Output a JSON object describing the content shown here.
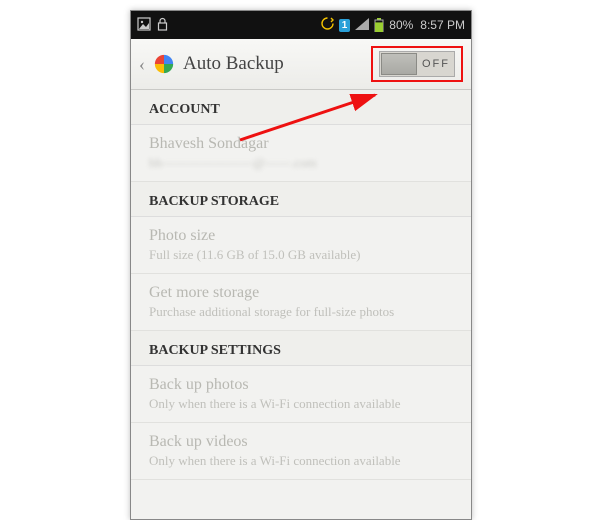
{
  "status_bar": {
    "sim_label": "1",
    "battery_text": "80%",
    "time": "8:57 PM"
  },
  "header": {
    "title": "Auto Backup",
    "toggle_state": "OFF"
  },
  "sections": {
    "account": {
      "header": "ACCOUNT",
      "name": "Bhavesh Sondagar",
      "email": "bh———————@——.com"
    },
    "storage": {
      "header": "BACKUP STORAGE",
      "photo_size_title": "Photo size",
      "photo_size_sub": "Full size (11.6 GB of 15.0 GB available)",
      "get_more_title": "Get more storage",
      "get_more_sub": "Purchase additional storage for full-size photos"
    },
    "settings": {
      "header": "BACKUP SETTINGS",
      "backup_photos_title": "Back up photos",
      "backup_photos_sub": "Only when there is a Wi-Fi connection available",
      "backup_videos_title": "Back up videos",
      "backup_videos_sub": "Only when there is a Wi-Fi connection available"
    }
  }
}
